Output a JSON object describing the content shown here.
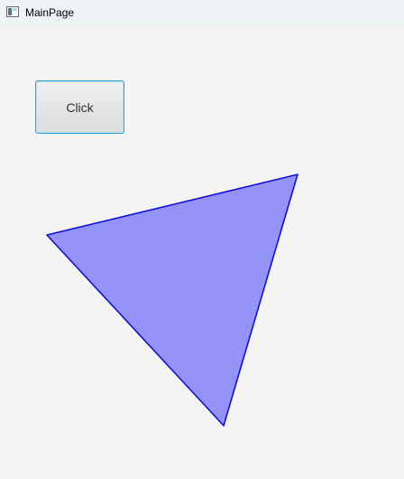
{
  "window": {
    "title": "MainPage",
    "icon": "window-app-icon"
  },
  "main": {
    "button_label": "Click",
    "triangle": {
      "fill_color": "#9393f9",
      "stroke_color": "#1010e0"
    }
  }
}
